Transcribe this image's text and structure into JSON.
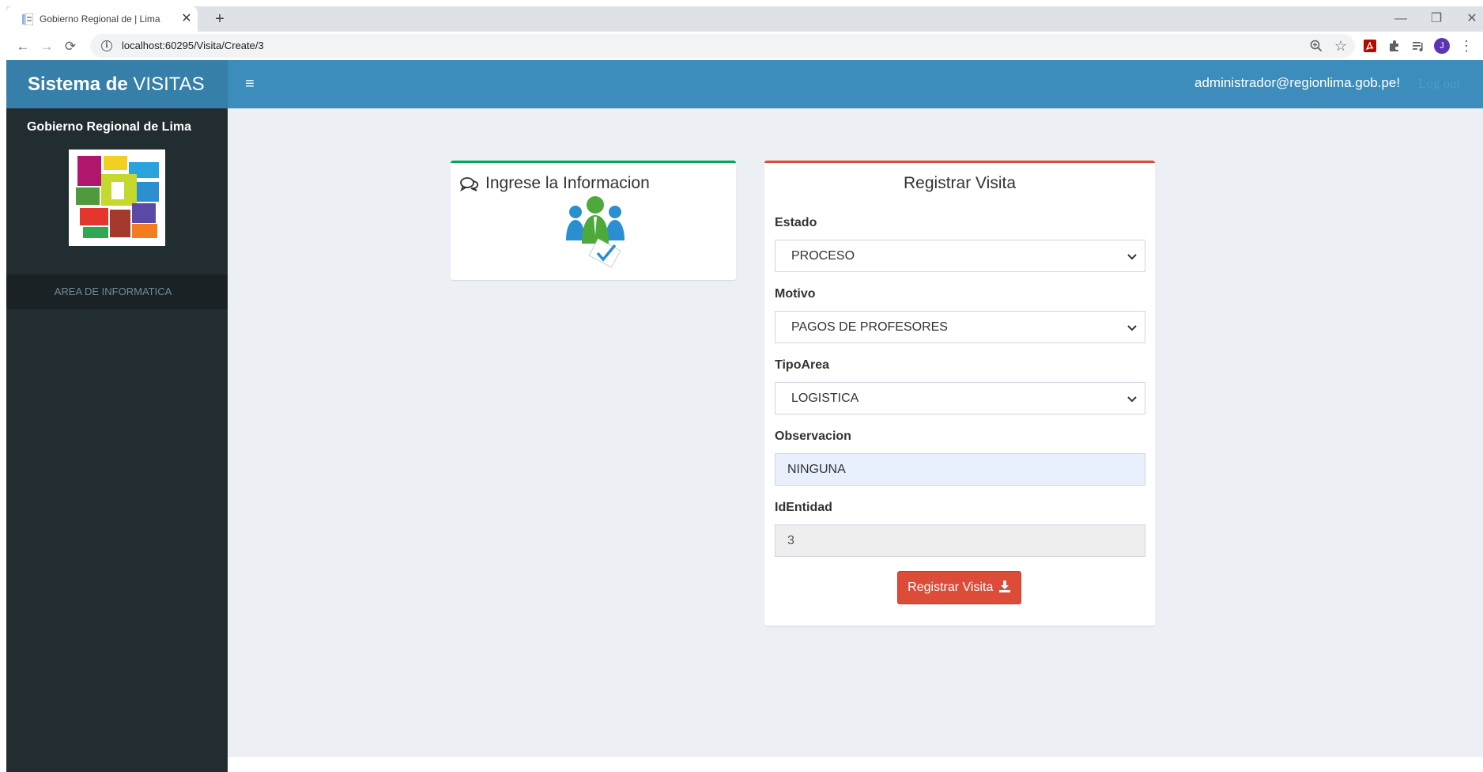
{
  "browser": {
    "tab_title": "Gobierno Regional de | Lima",
    "tab_close": "✕",
    "new_tab": "+",
    "url": "localhost:60295/Visita/Create/3",
    "avatar_initial": "J",
    "window_controls": {
      "minimize": "—",
      "restore": "❐",
      "close": "✕"
    }
  },
  "header": {
    "brand_bold": "Sistema de",
    "brand_rest": " VISITAS",
    "menu_icon": "≡",
    "user_email": "administrador@regionlima.gob.pe!",
    "logout": "Log out"
  },
  "sidebar": {
    "org_name": "Gobierno Regional de Lima",
    "area_item": "AREA DE INFORMATICA"
  },
  "info_box": {
    "title": "Ingrese la Informacion",
    "accent": "#00a65a"
  },
  "form": {
    "title": "Registrar Visita",
    "accent": "#dd4b39",
    "estado": {
      "label": "Estado",
      "value": "PROCESO"
    },
    "motivo": {
      "label": "Motivo",
      "value": "PAGOS DE PROFESORES"
    },
    "tipoarea": {
      "label": "TipoArea",
      "value": "LOGISTICA"
    },
    "observacion": {
      "label": "Observacion",
      "value": "NINGUNA"
    },
    "identidad": {
      "label": "IdEntidad",
      "value": "3"
    },
    "submit_label": "Registrar Visita"
  },
  "icons": {
    "back": "←",
    "forward": "→",
    "reload": "⟳",
    "info": "i",
    "zoom": "🔍",
    "star": "☆",
    "pdf": "pdf-icon",
    "puzzle": "puzzle-icon",
    "queue": "≡",
    "more": "⋮"
  },
  "colors": {
    "topnav": "#3c8dbc",
    "brand_bg": "#367fa9",
    "sidebar": "#222d32",
    "content_bg": "#ecf0f5"
  }
}
